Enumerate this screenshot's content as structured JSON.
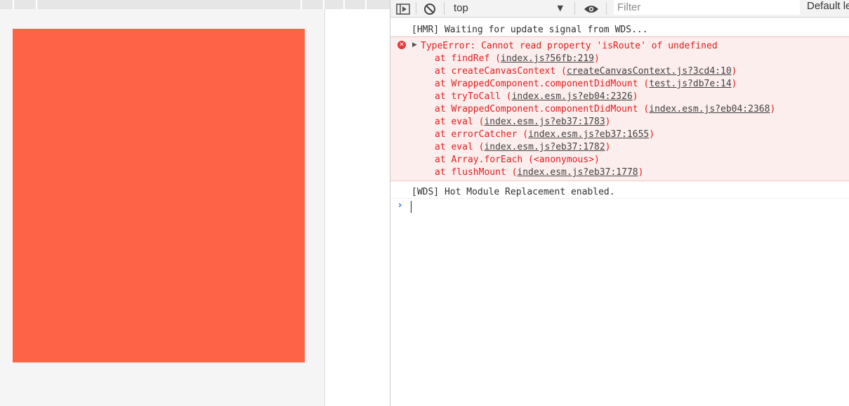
{
  "toolbar": {
    "context": "top",
    "context_arrow": "▼",
    "filter_placeholder": "Filter",
    "levels_label": "Default le"
  },
  "icons": {
    "sidebar": "sidebar-toggle-icon",
    "clear": "clear-console-icon",
    "eye": "live-expression-eye-icon",
    "error": "error-icon",
    "expand": "expand-triangle-icon",
    "prompt": "prompt-chevron-icon"
  },
  "colors": {
    "canvas": "#ff6347",
    "error_text": "#e21f1f",
    "error_bg": "#fdeeee",
    "prompt": "#1a73e8"
  },
  "console": {
    "hmr_message": "[HMR] Waiting for update signal from WDS...",
    "error": {
      "icon_glyph": "✕",
      "toggle_glyph": "▶",
      "message": "TypeError: Cannot read property 'isRoute' of undefined",
      "frames": [
        {
          "pre": "at findRef (",
          "link": "index.js?56fb:219",
          "post": ")"
        },
        {
          "pre": "at createCanvasContext (",
          "link": "createCanvasContext.js?3cd4:10",
          "post": ")"
        },
        {
          "pre": "at WrappedComponent.componentDidMount (",
          "link": "test.js?db7e:14",
          "post": ")"
        },
        {
          "pre": "at tryToCall (",
          "link": "index.esm.js?eb04:2326",
          "post": ")"
        },
        {
          "pre": "at WrappedComponent.componentDidMount (",
          "link": "index.esm.js?eb04:2368",
          "post": ")"
        },
        {
          "pre": "at eval (",
          "link": "index.esm.js?eb37:1783",
          "post": ")"
        },
        {
          "pre": "at errorCatcher (",
          "link": "index.esm.js?eb37:1655",
          "post": ")"
        },
        {
          "pre": "at eval (",
          "link": "index.esm.js?eb37:1782",
          "post": ")"
        },
        {
          "pre": "at Array.forEach (<anonymous>)",
          "link": "",
          "post": ""
        },
        {
          "pre": "at flushMount (",
          "link": "index.esm.js?eb37:1778",
          "post": ")"
        }
      ]
    },
    "wds_message": "[WDS] Hot Module Replacement enabled.",
    "prompt_glyph": "›"
  }
}
